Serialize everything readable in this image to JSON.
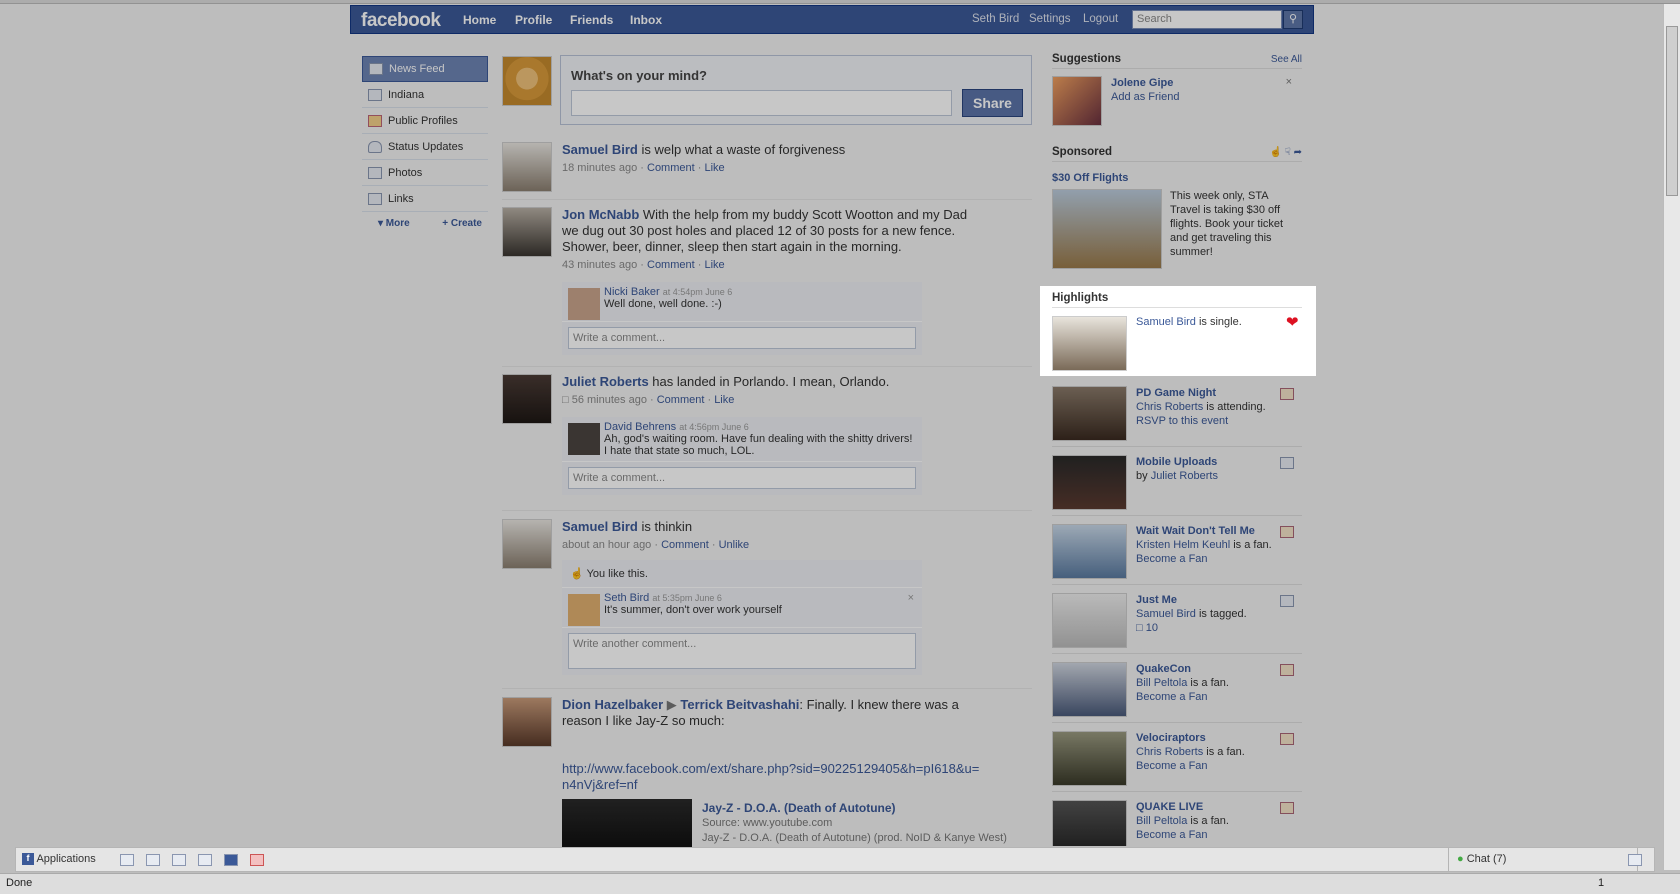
{
  "header": {
    "logo": "facebook",
    "nav": [
      "Home",
      "Profile",
      "Friends",
      "Inbox"
    ],
    "user": "Seth Bird",
    "settings": "Settings",
    "logout": "Logout",
    "search_placeholder": "Search"
  },
  "leftnav": {
    "items": [
      {
        "label": "News Feed",
        "icon": "news-feed-icon"
      },
      {
        "label": "Indiana",
        "icon": "network-icon"
      },
      {
        "label": "Public Profiles",
        "icon": "flag-icon"
      },
      {
        "label": "Status Updates",
        "icon": "person-icon"
      },
      {
        "label": "Photos",
        "icon": "photo-icon"
      },
      {
        "label": "Links",
        "icon": "link-icon"
      }
    ],
    "more": "▾ More",
    "create": "+ Create"
  },
  "status": {
    "prompt": "What's on your mind?",
    "share": "Share"
  },
  "feed": [
    {
      "name": "Samuel Bird",
      "text": " is welp what a waste of forgiveness",
      "time": "18 minutes ago",
      "comment": "Comment",
      "like": "Like"
    },
    {
      "name": "Jon McNabb",
      "text": " With the help from my buddy Scott Wootton and my Dad we dug out 30 post holes and placed 12 of 30 posts for a new fence. Shower, beer, dinner, sleep then start again in the morning.",
      "time": "43 minutes ago",
      "comment": "Comment",
      "like": "Like",
      "comments": [
        {
          "name": "Nicki Baker",
          "time": "at 4:54pm June 6",
          "text": "Well done, well done. :-)"
        }
      ],
      "input": "Write a comment..."
    },
    {
      "name": "Juliet Roberts",
      "text": " has landed in Porlando. I mean, Orlando.",
      "time": "56 minutes ago",
      "comment": "Comment",
      "like": "Like",
      "comments": [
        {
          "name": "David Behrens",
          "time": "at 4:56pm June 6",
          "text": "Ah, god's waiting room. Have fun dealing with the shitty drivers! I hate that state so much, LOL."
        }
      ],
      "input": "Write a comment..."
    },
    {
      "name": "Samuel Bird",
      "text": " is thinkin",
      "time": "about an hour ago",
      "comment": "Comment",
      "like": "Unlike",
      "likes": "You like this.",
      "comments": [
        {
          "name": "Seth Bird",
          "time": "at 5:35pm June 6",
          "text": "It's summer, don't over work yourself"
        }
      ],
      "input": "Write another comment..."
    },
    {
      "name": "Dion Hazelbaker",
      "name2": "Terrick Beitvashahi",
      "text": " Finally. I knew there was a reason I like Jay-Z so much:",
      "url": "http://www.facebook.com/ext/share.php?sid=90225129405&h=pI618&u=n4nVj&ref=nf",
      "video_title": "Jay-Z - D.O.A. (Death of Autotune)",
      "video_source": "Source: www.youtube.com",
      "video_desc": "Jay-Z - D.O.A. (Death of Autotune) (prod. NoID & Kanye West)"
    }
  ],
  "sidebar": {
    "suggestions_title": "Suggestions",
    "see_all": "See All",
    "suggestion": {
      "name": "Jolene Gipe",
      "action": "Add as Friend"
    },
    "sponsored_title": "Sponsored",
    "ad": {
      "title": "$30 Off Flights",
      "text": "This week only, STA Travel is taking $30 off flights. Book your ticket and get traveling this summer!"
    },
    "highlights_title": "Highlights",
    "highlight": {
      "name": "Samuel Bird",
      "text": " is single."
    },
    "items": [
      {
        "title": "PD Game Night",
        "line1_name": "Chris Roberts",
        "line1": " is attending.",
        "line2": "RSVP to this event",
        "icon": "calendar-icon"
      },
      {
        "title": "Mobile Uploads",
        "line1_pre": "by ",
        "line1_name": "Juliet Roberts",
        "line1": "",
        "line2": "",
        "icon": "photo-icon"
      },
      {
        "title": "Wait Wait Don't Tell Me",
        "line1_name": "Kristen Helm Keuhl",
        "line1": " is a fan.",
        "line2": "Become a Fan",
        "icon": "flag-icon"
      },
      {
        "title": "Just Me",
        "line1_name": "Samuel Bird",
        "line1": " is tagged.",
        "line2": "10",
        "icon": "photo-icon"
      },
      {
        "title": "QuakeCon",
        "line1_name": "Bill Peltola",
        "line1": " is a fan.",
        "line2": "Become a Fan",
        "icon": "flag-icon"
      },
      {
        "title": "Velociraptors",
        "line1_name": "Chris Roberts",
        "line1": " is a fan.",
        "line2": "Become a Fan",
        "icon": "flag-icon"
      },
      {
        "title": "QUAKE LIVE",
        "line1_name": "Bill Peltola",
        "line1": " is a fan.",
        "line2": "Become a Fan",
        "icon": "flag-icon"
      }
    ]
  },
  "bottombar": {
    "applications": "Applications",
    "chat": "Chat (7)"
  },
  "statusbar": {
    "text": "Done",
    "count": "1"
  }
}
